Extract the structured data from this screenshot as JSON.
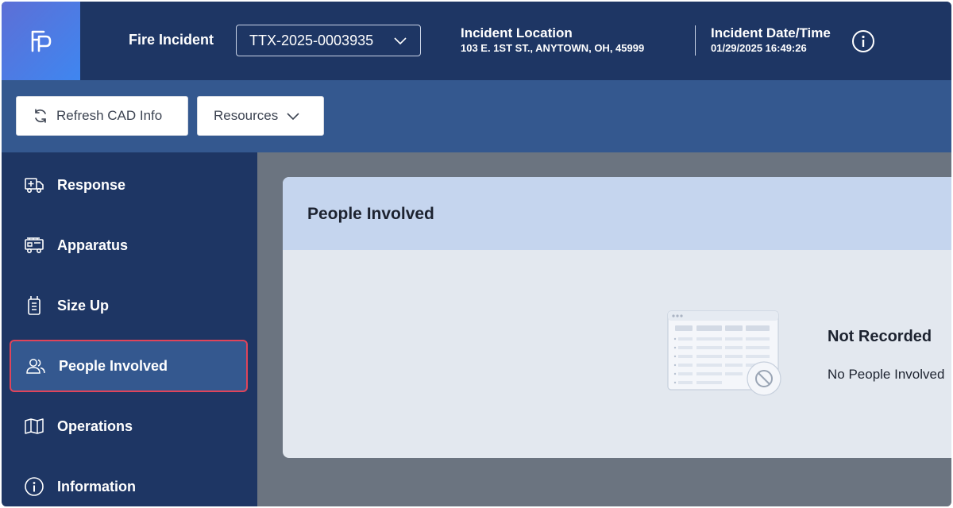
{
  "header": {
    "incident_type": "Fire Incident",
    "incident_number": "TTX-2025-0003935",
    "location_label": "Incident Location",
    "location_value": "103 E. 1ST ST., ANYTOWN, OH, 45999",
    "datetime_label": "Incident Date/Time",
    "datetime_value": "01/29/2025 16:49:26"
  },
  "toolbar": {
    "refresh_label": "Refresh CAD Info",
    "resources_label": "Resources"
  },
  "sidebar": {
    "items": [
      {
        "label": "Response",
        "icon": "ambulance-icon",
        "active": false
      },
      {
        "label": "Apparatus",
        "icon": "fire-truck-icon",
        "active": false
      },
      {
        "label": "Size Up",
        "icon": "radio-icon",
        "active": false
      },
      {
        "label": "People Involved",
        "icon": "people-icon",
        "active": true
      },
      {
        "label": "Operations",
        "icon": "map-icon",
        "active": false
      },
      {
        "label": "Information",
        "icon": "info-icon",
        "active": false
      }
    ]
  },
  "main": {
    "card_title": "People Involved",
    "empty_title": "Not Recorded",
    "empty_message": "No People Involved"
  },
  "colors": {
    "header_bg": "#1e3664",
    "toolbar_bg": "#34588f",
    "active_border": "#e0445a",
    "card_header_bg": "#c5d5ee"
  }
}
